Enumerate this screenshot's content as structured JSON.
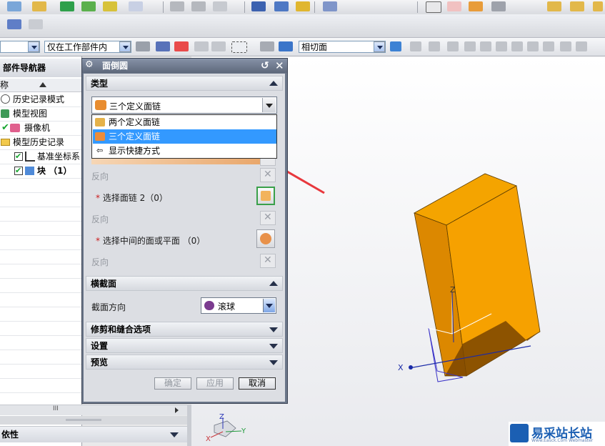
{
  "toolbar": {
    "filter_combo_value": "",
    "scope_combo_value": "仅在工作部件内",
    "section_combo_value": "相切面"
  },
  "navigator": {
    "title": "部件导航器",
    "column_label": "称",
    "items": [
      {
        "label": "历史记录模式"
      },
      {
        "label": "模型视图"
      },
      {
        "label": "摄像机"
      },
      {
        "label": "模型历史记录"
      },
      {
        "label": "基准坐标系"
      },
      {
        "label": "块 （1）"
      }
    ],
    "dependency_label": "依性",
    "scroll_marker": "III"
  },
  "dialog": {
    "title": "面倒圆",
    "type_section": "类型",
    "type_value": "三个定义面链",
    "dropdown_options": [
      {
        "label": "两个定义面链"
      },
      {
        "label": "三个定义面链"
      },
      {
        "label": "显示快捷方式"
      }
    ],
    "reverse_label": "反向",
    "select_chain2": "选择面链 2（0）",
    "select_middle": "选择中间的面或平面 （0）",
    "cross_section": "横截面",
    "section_direction_label": "截面方向",
    "section_direction_value": "滚球",
    "trim_section": "修剪和缝合选项",
    "settings_section": "设置",
    "preview_section": "预览",
    "ok": "确定",
    "apply": "应用",
    "cancel": "取消"
  },
  "viewport": {
    "axis_z": "Z",
    "axis_x": "X",
    "triad_z": "Z",
    "triad_x": "X",
    "triad_y": "Y"
  },
  "watermark": {
    "title": "易采站长站",
    "url": "Www.Easck.Com Webmaster"
  },
  "colors": {
    "block_front": "#dd8a00",
    "block_side": "#f4a400",
    "block_top": "#ffb81a",
    "highlight": "#3399ff",
    "arrow": "#e8383d"
  }
}
